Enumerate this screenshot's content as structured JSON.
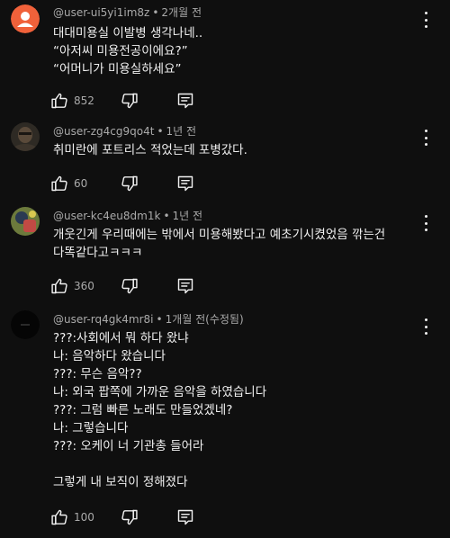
{
  "comments": [
    {
      "author": "@user-ui5yi1im8z",
      "time": "2개월 전",
      "lines": [
        "대대미용실 이발병 생각나네..",
        "“아저씨 미용전공이에요?”",
        "“어머니가 미용실하세요”"
      ],
      "likes": "852",
      "avatar": {
        "type": "default",
        "color": "#f0613a"
      }
    },
    {
      "author": "@user-zg4cg9qo4t",
      "time": "1년 전",
      "lines": [
        "취미란에 포트리스 적었는데 포병갔다."
      ],
      "likes": "60",
      "avatar": {
        "type": "photo"
      }
    },
    {
      "author": "@user-kc4eu8dm1k",
      "time": "1년 전",
      "lines": [
        "개웃긴게 우리때에는 밖에서 미용해봤다고 예초기시켰었음 깎는건",
        "다똑같다고ㅋㅋㅋ"
      ],
      "likes": "360",
      "avatar": {
        "type": "photo"
      }
    },
    {
      "author": "@user-rq4gk4mr8i",
      "time": "1개월 전(수정됨)",
      "lines": [
        "???:사회에서 뭐 하다 왔냐",
        "나: 음악하다 왔습니다",
        "???: 무슨 음악??",
        "나: 외국 팝쪽에 가까운 음악을 하였습니다",
        "???: 그럼 빠른 노래도 만들었겠네?",
        "나: 그렇습니다",
        "???: 오케이 너 기관총 들어라",
        "",
        "그렇게 내 보직이 정해졌다"
      ],
      "likes": "100",
      "avatar": {
        "type": "dark"
      }
    }
  ],
  "icons": {
    "like": "thumb-up-icon",
    "dislike": "thumb-down-icon",
    "reply": "reply-icon",
    "menu": "more-vertical-icon"
  }
}
